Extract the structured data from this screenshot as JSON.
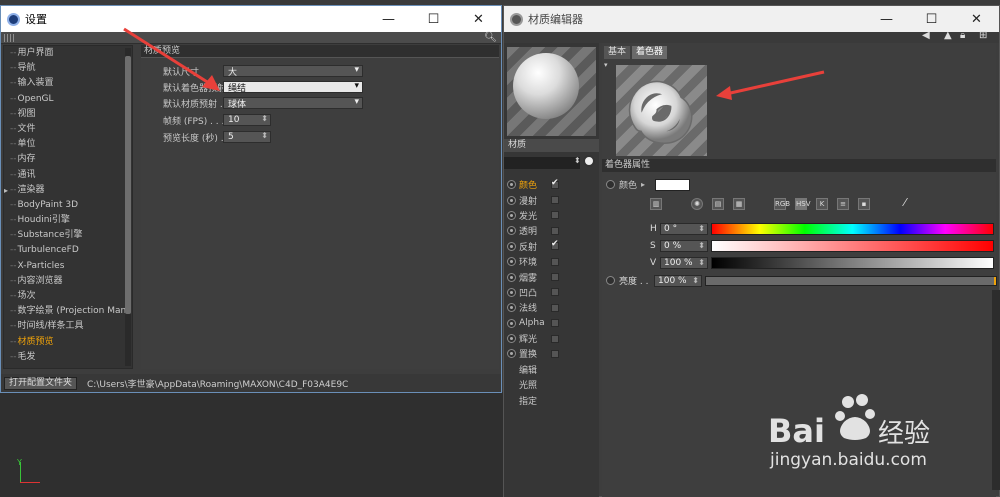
{
  "settings": {
    "title": "设置",
    "tree": [
      {
        "label": "用户界面",
        "active": false,
        "arrow": false
      },
      {
        "label": "导航",
        "active": false,
        "arrow": false
      },
      {
        "label": "输入装置",
        "active": false,
        "arrow": false
      },
      {
        "label": "OpenGL",
        "active": false,
        "arrow": false
      },
      {
        "label": "视图",
        "active": false,
        "arrow": false
      },
      {
        "label": "文件",
        "active": false,
        "arrow": false
      },
      {
        "label": "单位",
        "active": false,
        "arrow": false
      },
      {
        "label": "内存",
        "active": false,
        "arrow": false
      },
      {
        "label": "通讯",
        "active": false,
        "arrow": false
      },
      {
        "label": "渲染器",
        "active": false,
        "arrow": true
      },
      {
        "label": "BodyPaint 3D",
        "active": false,
        "arrow": false
      },
      {
        "label": "Houdini引擎",
        "active": false,
        "arrow": false
      },
      {
        "label": "Substance引擎",
        "active": false,
        "arrow": false
      },
      {
        "label": "TurbulenceFD",
        "active": false,
        "arrow": false
      },
      {
        "label": "X-Particles",
        "active": false,
        "arrow": false
      },
      {
        "label": "内容浏览器",
        "active": false,
        "arrow": false
      },
      {
        "label": "场次",
        "active": false,
        "arrow": false
      },
      {
        "label": "数字绘景 (Projection Man)",
        "active": false,
        "arrow": false
      },
      {
        "label": "时间线/样条工具",
        "active": false,
        "arrow": false
      },
      {
        "label": "材质预览",
        "active": true,
        "arrow": false
      },
      {
        "label": "毛发",
        "active": false,
        "arrow": false
      }
    ],
    "panel_header": "材质预览",
    "fields": {
      "default_size": {
        "label": "默认尺寸",
        "value": "大"
      },
      "default_shader_preview": {
        "label": "默认着色器预射",
        "value": "绳结"
      },
      "default_material_preview": {
        "label": "默认材质预射 . .",
        "value": "球体"
      },
      "fps": {
        "label": "帧频 (FPS) . . . .",
        "value": "10"
      },
      "preview_length": {
        "label": "预览长度 (秒) . .",
        "value": "5"
      }
    },
    "footer": {
      "open_config_button": "打开配置文件夹",
      "path": "C:\\Users\\李世豪\\AppData\\Roaming\\MAXON\\C4D_F03A4E9C"
    }
  },
  "material_editor": {
    "title": "材质编辑器",
    "material_name": "材质",
    "channels": [
      {
        "label": "颜色",
        "active": true,
        "checked": true,
        "has_box": true
      },
      {
        "label": "漫射",
        "active": false,
        "checked": false,
        "has_box": true
      },
      {
        "label": "发光",
        "active": false,
        "checked": false,
        "has_box": true
      },
      {
        "label": "透明",
        "active": false,
        "checked": false,
        "has_box": true
      },
      {
        "label": "反射",
        "active": false,
        "checked": true,
        "has_box": true
      },
      {
        "label": "环境",
        "active": false,
        "checked": false,
        "has_box": true
      },
      {
        "label": "烟雾",
        "active": false,
        "checked": false,
        "has_box": true
      },
      {
        "label": "凹凸",
        "active": false,
        "checked": false,
        "has_box": true
      },
      {
        "label": "法线",
        "active": false,
        "checked": false,
        "has_box": true
      },
      {
        "label": "Alpha",
        "active": false,
        "checked": false,
        "has_box": true
      },
      {
        "label": "辉光",
        "active": false,
        "checked": false,
        "has_box": true
      },
      {
        "label": "置换",
        "active": false,
        "checked": false,
        "has_box": true
      },
      {
        "label": "编辑",
        "active": false,
        "checked": false,
        "has_box": false
      },
      {
        "label": "光照",
        "active": false,
        "checked": false,
        "has_box": false
      },
      {
        "label": "指定",
        "active": false,
        "checked": false,
        "has_box": false
      }
    ],
    "tabs": [
      {
        "label": "基本",
        "active": false
      },
      {
        "label": "着色器",
        "active": true
      }
    ],
    "section_header": "着色器属性",
    "color_label": "颜色",
    "swatch_color": "#ffffff",
    "icon_labels": {
      "rgb": "RGB",
      "hsv": "HSV",
      "k": "K"
    },
    "hsv": {
      "h": {
        "key": "H",
        "value": "0 °"
      },
      "s": {
        "key": "S",
        "value": "0 %"
      },
      "v": {
        "key": "V",
        "value": "100 %"
      }
    },
    "brightness": {
      "label": "亮度 . .",
      "value": "100 %"
    }
  },
  "watermark": {
    "text": "jingyan.baidu.com"
  },
  "colors": {
    "accent": "#f0a30a",
    "arrow": "#e8403a",
    "window_border": "#6a8fb8"
  }
}
